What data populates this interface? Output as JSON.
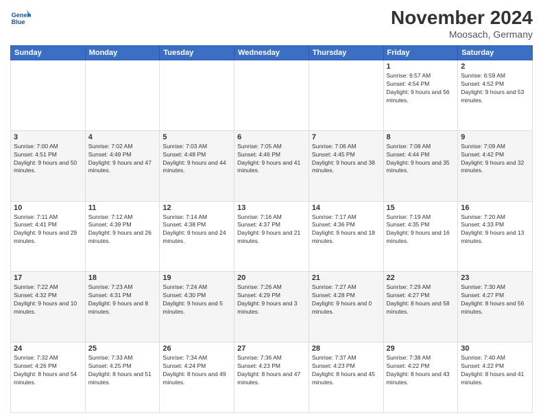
{
  "logo": {
    "text_line1": "General",
    "text_line2": "Blue"
  },
  "header": {
    "title": "November 2024",
    "subtitle": "Moosach, Germany"
  },
  "weekdays": [
    "Sunday",
    "Monday",
    "Tuesday",
    "Wednesday",
    "Thursday",
    "Friday",
    "Saturday"
  ],
  "weeks": [
    [
      {
        "day": "",
        "info": ""
      },
      {
        "day": "",
        "info": ""
      },
      {
        "day": "",
        "info": ""
      },
      {
        "day": "",
        "info": ""
      },
      {
        "day": "",
        "info": ""
      },
      {
        "day": "1",
        "info": "Sunrise: 6:57 AM\nSunset: 4:54 PM\nDaylight: 9 hours and 56 minutes."
      },
      {
        "day": "2",
        "info": "Sunrise: 6:59 AM\nSunset: 4:52 PM\nDaylight: 9 hours and 53 minutes."
      }
    ],
    [
      {
        "day": "3",
        "info": "Sunrise: 7:00 AM\nSunset: 4:51 PM\nDaylight: 9 hours and 50 minutes."
      },
      {
        "day": "4",
        "info": "Sunrise: 7:02 AM\nSunset: 4:49 PM\nDaylight: 9 hours and 47 minutes."
      },
      {
        "day": "5",
        "info": "Sunrise: 7:03 AM\nSunset: 4:48 PM\nDaylight: 9 hours and 44 minutes."
      },
      {
        "day": "6",
        "info": "Sunrise: 7:05 AM\nSunset: 4:46 PM\nDaylight: 9 hours and 41 minutes."
      },
      {
        "day": "7",
        "info": "Sunrise: 7:06 AM\nSunset: 4:45 PM\nDaylight: 9 hours and 38 minutes."
      },
      {
        "day": "8",
        "info": "Sunrise: 7:08 AM\nSunset: 4:44 PM\nDaylight: 9 hours and 35 minutes."
      },
      {
        "day": "9",
        "info": "Sunrise: 7:09 AM\nSunset: 4:42 PM\nDaylight: 9 hours and 32 minutes."
      }
    ],
    [
      {
        "day": "10",
        "info": "Sunrise: 7:11 AM\nSunset: 4:41 PM\nDaylight: 9 hours and 29 minutes."
      },
      {
        "day": "11",
        "info": "Sunrise: 7:12 AM\nSunset: 4:39 PM\nDaylight: 9 hours and 26 minutes."
      },
      {
        "day": "12",
        "info": "Sunrise: 7:14 AM\nSunset: 4:38 PM\nDaylight: 9 hours and 24 minutes."
      },
      {
        "day": "13",
        "info": "Sunrise: 7:16 AM\nSunset: 4:37 PM\nDaylight: 9 hours and 21 minutes."
      },
      {
        "day": "14",
        "info": "Sunrise: 7:17 AM\nSunset: 4:36 PM\nDaylight: 9 hours and 18 minutes."
      },
      {
        "day": "15",
        "info": "Sunrise: 7:19 AM\nSunset: 4:35 PM\nDaylight: 9 hours and 16 minutes."
      },
      {
        "day": "16",
        "info": "Sunrise: 7:20 AM\nSunset: 4:33 PM\nDaylight: 9 hours and 13 minutes."
      }
    ],
    [
      {
        "day": "17",
        "info": "Sunrise: 7:22 AM\nSunset: 4:32 PM\nDaylight: 9 hours and 10 minutes."
      },
      {
        "day": "18",
        "info": "Sunrise: 7:23 AM\nSunset: 4:31 PM\nDaylight: 9 hours and 8 minutes."
      },
      {
        "day": "19",
        "info": "Sunrise: 7:24 AM\nSunset: 4:30 PM\nDaylight: 9 hours and 5 minutes."
      },
      {
        "day": "20",
        "info": "Sunrise: 7:26 AM\nSunset: 4:29 PM\nDaylight: 9 hours and 3 minutes."
      },
      {
        "day": "21",
        "info": "Sunrise: 7:27 AM\nSunset: 4:28 PM\nDaylight: 9 hours and 0 minutes."
      },
      {
        "day": "22",
        "info": "Sunrise: 7:29 AM\nSunset: 4:27 PM\nDaylight: 8 hours and 58 minutes."
      },
      {
        "day": "23",
        "info": "Sunrise: 7:30 AM\nSunset: 4:27 PM\nDaylight: 8 hours and 56 minutes."
      }
    ],
    [
      {
        "day": "24",
        "info": "Sunrise: 7:32 AM\nSunset: 4:26 PM\nDaylight: 8 hours and 54 minutes."
      },
      {
        "day": "25",
        "info": "Sunrise: 7:33 AM\nSunset: 4:25 PM\nDaylight: 8 hours and 51 minutes."
      },
      {
        "day": "26",
        "info": "Sunrise: 7:34 AM\nSunset: 4:24 PM\nDaylight: 8 hours and 49 minutes."
      },
      {
        "day": "27",
        "info": "Sunrise: 7:36 AM\nSunset: 4:23 PM\nDaylight: 8 hours and 47 minutes."
      },
      {
        "day": "28",
        "info": "Sunrise: 7:37 AM\nSunset: 4:23 PM\nDaylight: 8 hours and 45 minutes."
      },
      {
        "day": "29",
        "info": "Sunrise: 7:38 AM\nSunset: 4:22 PM\nDaylight: 8 hours and 43 minutes."
      },
      {
        "day": "30",
        "info": "Sunrise: 7:40 AM\nSunset: 4:22 PM\nDaylight: 8 hours and 41 minutes."
      }
    ]
  ]
}
